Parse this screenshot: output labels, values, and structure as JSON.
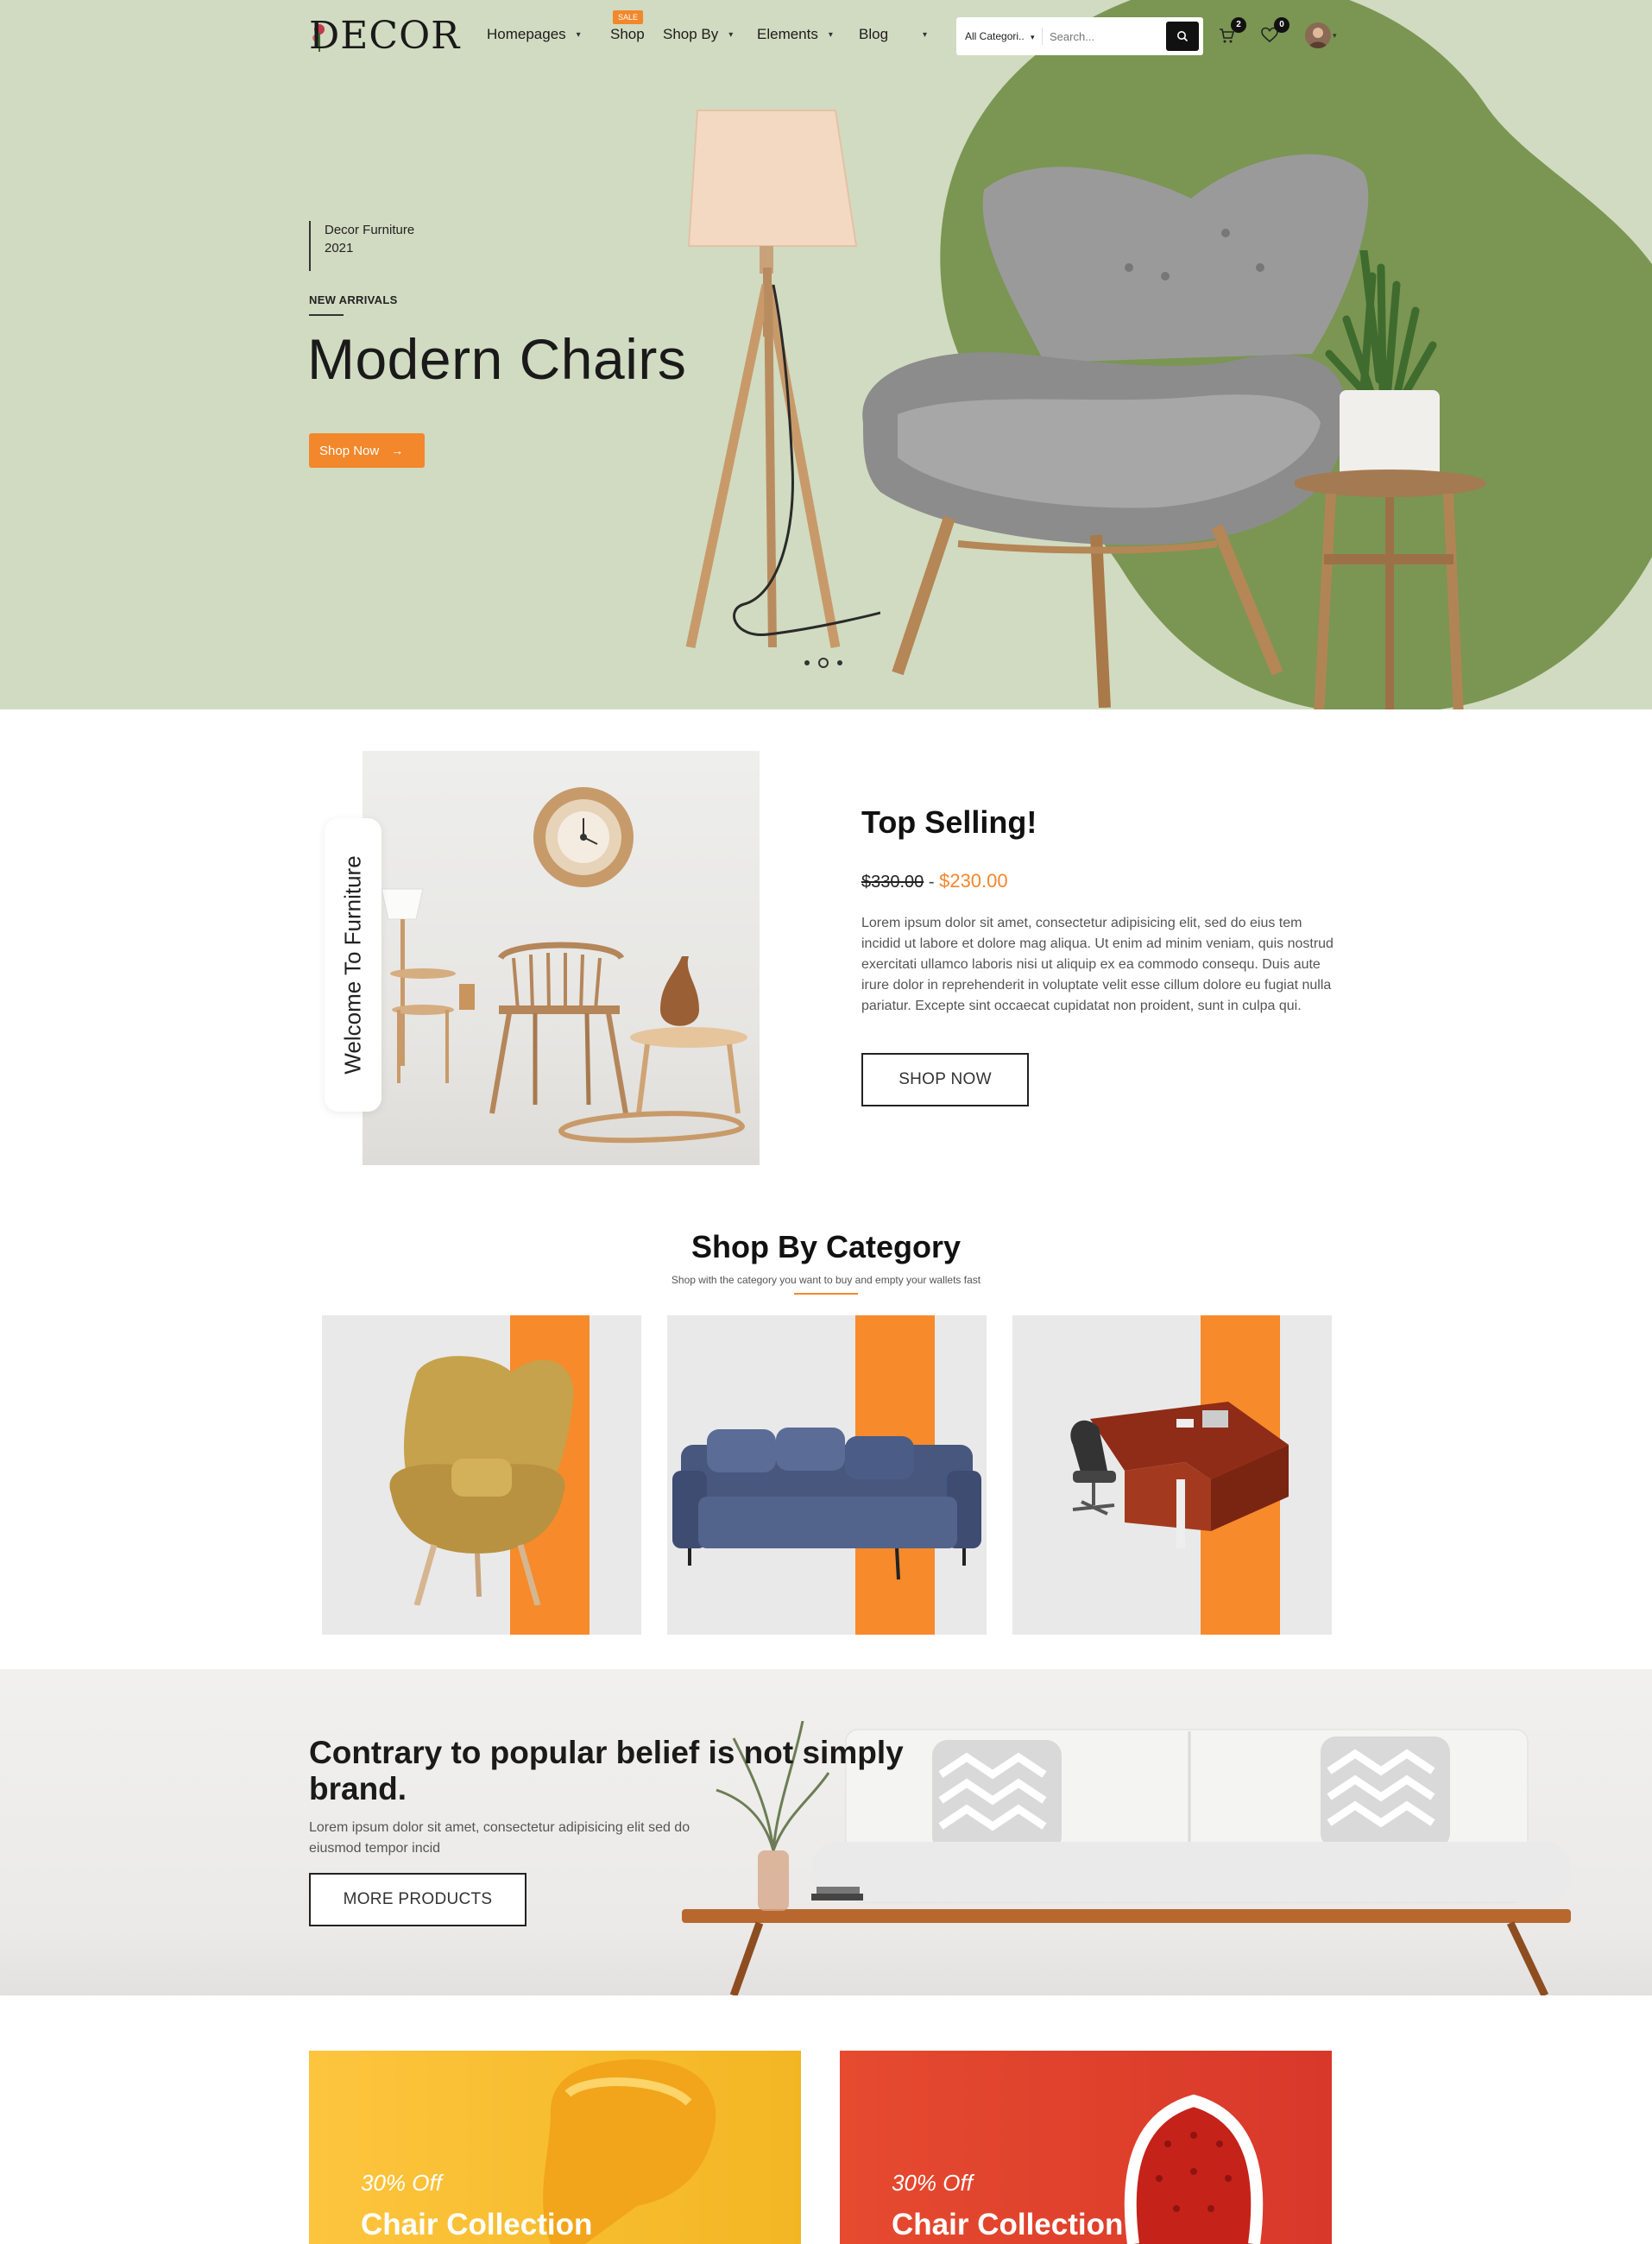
{
  "header": {
    "logo": "DECOR",
    "nav": [
      {
        "label": "Homepages",
        "has_dropdown": true
      },
      {
        "label": "Shop",
        "has_dropdown": false,
        "badge": "SALE"
      },
      {
        "label": "Shop By",
        "has_dropdown": true
      },
      {
        "label": "Elements",
        "has_dropdown": true
      },
      {
        "label": "Blog",
        "has_dropdown": true
      }
    ],
    "search": {
      "category": "All Categori..",
      "placeholder": "Search..."
    },
    "cart_count": "2",
    "wishlist_count": "0"
  },
  "hero": {
    "brand_line1": "Decor Furniture",
    "brand_line2": "2021",
    "eyebrow": "NEW ARRIVALS",
    "title": "Modern Chairs",
    "button_label": "Shop Now",
    "slides": 3,
    "active_slide": 2
  },
  "top_selling": {
    "side_label": "Welcome To Furniture",
    "title": "Top Selling!",
    "old_price": "$330.00",
    "separator": "-",
    "new_price": "$230.00",
    "description": "Lorem ipsum dolor sit amet, consectetur adipisicing elit, sed do eius tem incidid ut labore et dolore mag aliqua. Ut enim ad minim veniam, quis nostrud exercitati ullamco laboris nisi ut aliquip ex ea commodo consequ. Duis aute irure dolor in reprehenderit in voluptate velit esse cillum dolore eu fugiat nulla pariatur. Excepte sint occaecat cupidatat non proident, sunt in culpa qui.",
    "button_label": "SHOP NOW"
  },
  "category": {
    "title": "Shop By Category",
    "subtitle": "Shop with the category you want to buy and empty your wallets fast",
    "items": [
      "armchair",
      "sofa",
      "office-desk"
    ]
  },
  "banner": {
    "title": "Contrary to popular belief is not simply brand.",
    "text": "Lorem ipsum dolor sit amet, consectetur adipisicing elit sed do eiusmod tempor incid",
    "button_label": "MORE PRODUCTS"
  },
  "promos": [
    {
      "discount": "30% Off",
      "title": "Chair Collection",
      "color": "#f7b928"
    },
    {
      "discount": "30% Off",
      "title": "Chair Collection",
      "color": "#e0402a"
    }
  ],
  "colors": {
    "accent": "#f2872b",
    "hero_bg": "#d1dbc1",
    "blob": "#7a9652",
    "dark": "#111111"
  }
}
